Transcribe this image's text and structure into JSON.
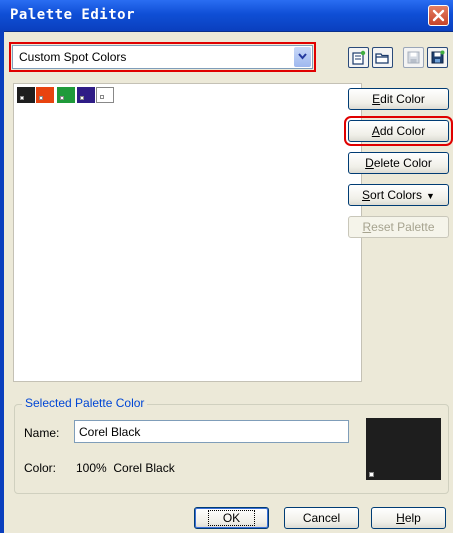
{
  "window": {
    "title": "Palette Editor",
    "close_icon": "close-icon"
  },
  "palette_select": {
    "value": "Custom Spot Colors"
  },
  "toolbar": {
    "icons": [
      "new-palette-icon",
      "open-palette-icon",
      "save-palette-icon",
      "save-as-palette-icon"
    ]
  },
  "swatches": [
    {
      "color": "#1e1e1e",
      "name": "Corel Black"
    },
    {
      "color": "#e8430f"
    },
    {
      "color": "#1f9a3a"
    },
    {
      "color": "#2f1c86"
    },
    {
      "color": "#ffffff"
    }
  ],
  "buttons": {
    "edit_color": {
      "label": "Edit Color",
      "mnemonic": "E"
    },
    "add_color": {
      "label": "Add Color",
      "mnemonic": "A"
    },
    "delete_color": {
      "label": "Delete Color",
      "mnemonic": "D"
    },
    "sort_colors": {
      "label": "Sort Colors",
      "mnemonic": "S"
    },
    "reset_palette": {
      "label": "Reset Palette",
      "mnemonic": "R"
    }
  },
  "selected": {
    "group_title": "Selected Palette Color",
    "name_label": "Name:",
    "name_value": "Corel Black",
    "color_label": "Color:",
    "color_value": "100%  Corel Black",
    "preview_color": "#1e1e1e"
  },
  "footer": {
    "ok": "OK",
    "cancel": "Cancel",
    "help": "Help"
  },
  "colors": {
    "highlight": "#e00000",
    "title_bar": "#0f4fd6",
    "group_title": "#0046d5"
  }
}
